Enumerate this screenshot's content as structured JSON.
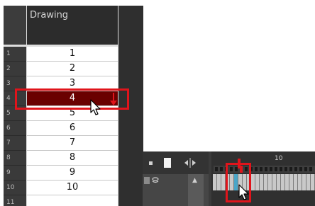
{
  "xsheet": {
    "column_title": "Drawing",
    "rows": [
      {
        "num": "1",
        "value": "1"
      },
      {
        "num": "2",
        "value": "2"
      },
      {
        "num": "3",
        "value": "3"
      },
      {
        "num": "4",
        "value": "4"
      },
      {
        "num": "5",
        "value": "5"
      },
      {
        "num": "6",
        "value": "6"
      },
      {
        "num": "7",
        "value": "7"
      },
      {
        "num": "8",
        "value": "8"
      },
      {
        "num": "9",
        "value": "9"
      },
      {
        "num": "10",
        "value": "10"
      },
      {
        "num": "11",
        "value": ""
      }
    ],
    "selected_row": "4"
  },
  "timeline": {
    "ruler_label": "10",
    "header_icons": [
      "square-icon",
      "white-rect-icon",
      "split-arrows-icon"
    ]
  },
  "colors": {
    "highlight": "#e0141b",
    "selected_cell": "#6a0000",
    "active_frame": "#4aa6c8"
  },
  "icons": [
    "mouse-cursor-icon",
    "down-arrow-icon",
    "scroll-up-icon"
  ]
}
